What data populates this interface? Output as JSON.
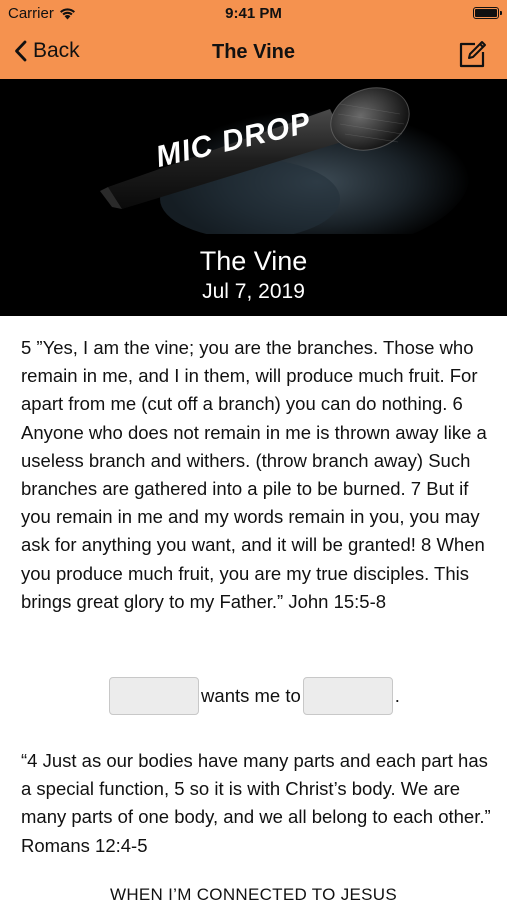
{
  "status_bar": {
    "carrier": "Carrier",
    "time": "9:41 PM"
  },
  "nav": {
    "back_label": "Back",
    "title": "The Vine"
  },
  "banner": {
    "logo_text": "MIC DROP"
  },
  "header": {
    "title": "The Vine",
    "date": "Jul 7, 2019"
  },
  "content": {
    "paragraph1": "5 ”Yes, I am the vine; you are the branches. Those who remain in me, and I in them, will produce much fruit. For apart from me (cut off a branch) you can do nothing. 6 Anyone who does not remain in me is thrown away like a useless branch and withers. (throw branch away) Such branches are gathered into a pile to be burned. 7 But if you remain in me and my words remain in you, you may ask for anything you want, and it will be granted! 8 When you produce much fruit, you are my true disciples. This brings great glory to my Father.” John 15:5-8",
    "fill_in": {
      "middle_text": "wants me to",
      "end_text": ".",
      "blank1_value": "",
      "blank2_value": ""
    },
    "paragraph2": "“4 Just as our bodies have many parts and each part has a special function, 5 so it is with Christ’s body. We are many parts of one body, and we all belong to each other.” Romans 12:4-5",
    "cut_off_heading": "WHEN I’M CONNECTED TO JESUS"
  }
}
